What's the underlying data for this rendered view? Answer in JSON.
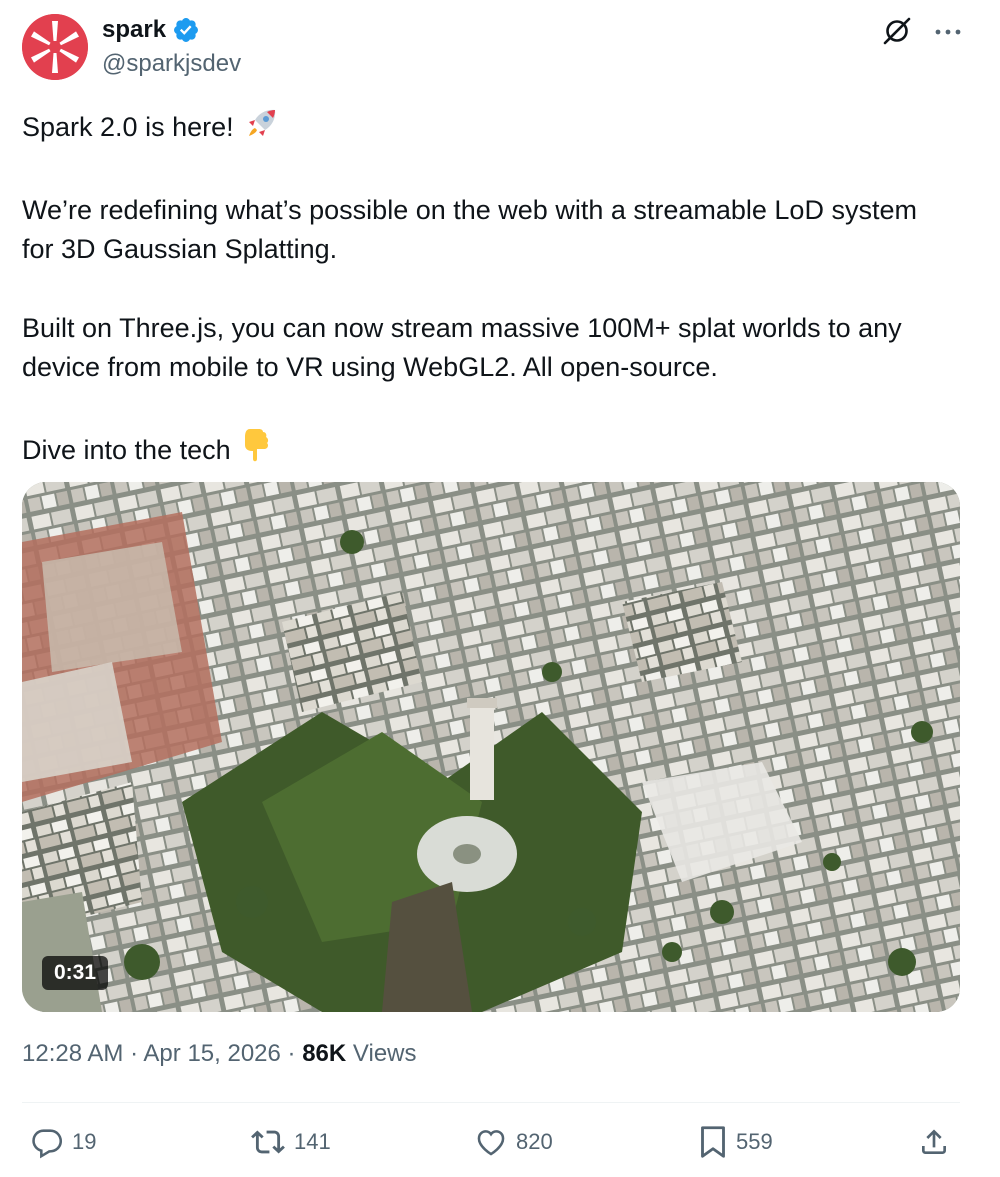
{
  "author": {
    "display_name": "spark",
    "handle": "@sparkjsdev",
    "verified": true,
    "avatar_color": "#e2404f"
  },
  "header_icons": [
    "grok-icon",
    "more-icon"
  ],
  "tweet": {
    "line1": "Spark 2.0 is here! ",
    "line2": "We’re redefining what’s possible on the web with a streamable LoD system for 3D Gaussian Splatting.",
    "line3": "Built on Three.js, you can now stream massive 100M+ splat worlds to any device from mobile to VR using WebGL2. All open-source.",
    "line4": "Dive into the tech ",
    "emoji1": "rocket-emoji",
    "emoji2": "pointing-down-emoji"
  },
  "media": {
    "type": "video",
    "duration": "0:31"
  },
  "meta": {
    "time": "12:28 AM",
    "separator": "·",
    "date": "Apr 15, 2026",
    "views_count": "86K",
    "views_label": "Views"
  },
  "actions": {
    "replies": "19",
    "reposts": "141",
    "likes": "820",
    "bookmarks": "559"
  },
  "colors": {
    "text": "#0f1419",
    "secondary": "#536471",
    "verified": "#1d9bf0",
    "divider": "#eff3f4"
  }
}
